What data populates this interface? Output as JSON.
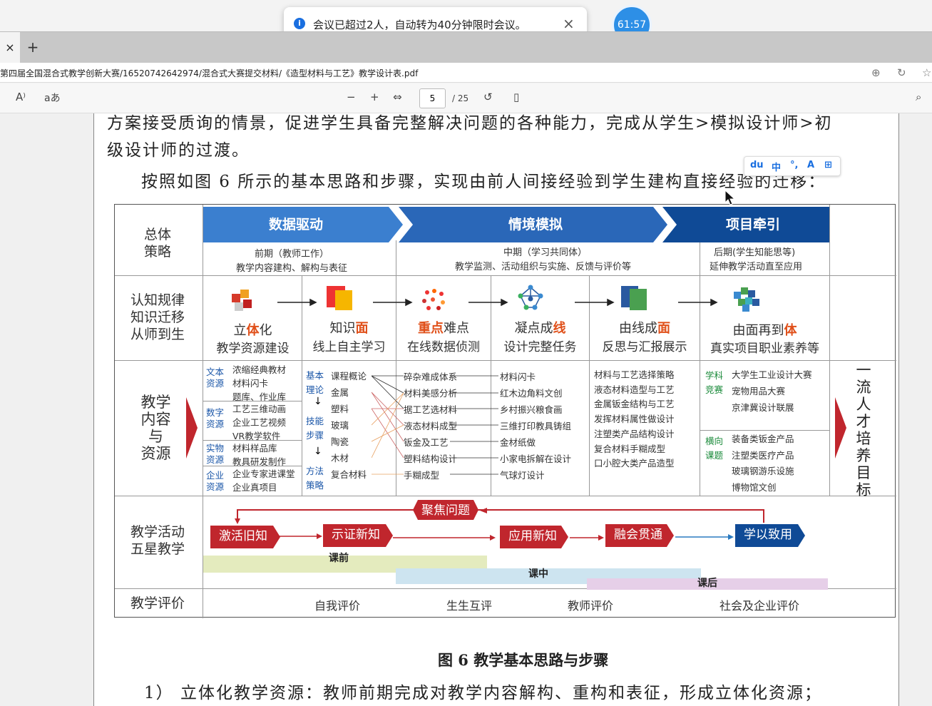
{
  "toast": {
    "message": "会议已超过2人，自动转为40分钟限时会议。",
    "close": "×",
    "info": "i"
  },
  "timer": "61:57",
  "browser": {
    "tab_close": "×",
    "new_tab": "+",
    "url": "第四届全国混合式教学创新大赛/16520742642974/混合式大赛提交材料/《造型材料与工艺》教学设计表.pdf"
  },
  "pdf_toolbar": {
    "read_aloud": "A⁾",
    "translate": "aあ",
    "zoom_out": "−",
    "zoom_in": "+",
    "page": "5",
    "total": "/ 25"
  },
  "ime": {
    "labels": [
      "du",
      "中",
      "°,",
      "A",
      "⊞"
    ]
  },
  "doc": {
    "line1": "方案接受质询的情景，促进学生具备完整解决问题的各种能力，完成从学生>模拟设计师>初",
    "line2": "级设计师的过渡。",
    "line3": "按照如图 6 所示的基本思路和步骤，实现由前人间接经验到学生建构直接经验的迁移：",
    "caption": "图 6 教学基本思路与步骤",
    "line4": "1） 立体化教学资源：教师前期完成对教学内容解构、重构和表征，形成立体化资源；"
  },
  "diagram": {
    "row_labels": {
      "strategy": "总体\n策略",
      "cognition": "认知规律\n知识迁移\n从师到生",
      "content": "教学\n内容\n与\n资源",
      "activity": "教学活动\n五星教学",
      "evaluation": "教学评价"
    },
    "bands": [
      "数据驱动",
      "情境模拟",
      "项目牵引"
    ],
    "band_subs": [
      {
        "a": "前期（教师工作）",
        "b": "教学内容建构、解构与表征"
      },
      {
        "a": "中期（学习共同体）",
        "b": "教学监测、活动组织与实施、反馈与评价等"
      },
      {
        "a": "后期(学生知能思等)",
        "b": "延伸教学活动直至应用"
      }
    ],
    "cog": [
      {
        "pre": "立",
        "hi": "体",
        "post": "化",
        "sub": "教学资源建设"
      },
      {
        "pre": "知识",
        "hi": "面",
        "post": "",
        "sub": "线上自主学习"
      },
      {
        "pre": "重",
        "hi": "点",
        "post": "难点",
        "sub": "在线数据侦测"
      },
      {
        "pre": "凝点成",
        "hi": "线",
        "post": "",
        "sub": "设计完整任务"
      },
      {
        "pre": "由线成",
        "hi": "面",
        "post": "",
        "sub": "反思与汇报展示"
      },
      {
        "pre": "由面再到",
        "hi": "体",
        "post": "",
        "sub": "真实项目职业素养等"
      }
    ],
    "res_types": [
      {
        "label": "文本\n资源",
        "items": "浓缩经典教材\n材料闪卡\n题库、作业库"
      },
      {
        "label": "数字\n资源",
        "items": "工艺三维动画\n企业工艺视频\nVR教学软件"
      },
      {
        "label": "实物\n资源",
        "items": "材料样品库\n教具研发制作"
      },
      {
        "label": "企业\n资源",
        "items": "企业专家进课堂\n企业真项目"
      }
    ],
    "theory": {
      "a": "基本\n理论",
      "b": "技能\n步骤",
      "c": "方法\n策略"
    },
    "materials": [
      "课程概论",
      "金属",
      "塑料",
      "玻璃",
      "陶瓷",
      "木材",
      "复合材料"
    ],
    "processes": [
      "碎杂难成体系",
      "材料美感分析",
      "据工艺选材料",
      "液态材料成型",
      "钣金及工艺",
      "塑料结构设计",
      "手糊成型"
    ],
    "outputs": [
      "材料闪卡",
      "红木边角料文创",
      "乡村振兴粮食画",
      "三维打印教具铸组",
      "金材纸做",
      "小家电拆解在设计",
      "气球灯设计"
    ],
    "topics": [
      "材料与工艺选择策略",
      "液态材料造型与工艺",
      "金属钣金结构与工艺",
      "发挥材料属性做设计",
      "注塑类产品结构设计",
      "复合材料手糊成型",
      "口小腔大类产品造型"
    ],
    "contest_label": "学科\n竞赛",
    "contests": [
      "大学生工业设计大赛",
      "宠物用品大赛",
      "京津冀设计联展"
    ],
    "project_label": "横向\n课题",
    "projects": [
      "装备类钣金产品",
      "注塑类医疗产品",
      "玻璃钢游乐设施",
      "博物馆文创"
    ],
    "goal": "一流人才培养目标",
    "focus": "聚焦问题",
    "steps": [
      "激活旧知",
      "示证新知",
      "应用新知",
      "融会贯通",
      "学以致用"
    ],
    "phases": [
      "课前",
      "课中",
      "课后"
    ],
    "evals": [
      "自我评价",
      "生生互评",
      "教师评价",
      "社会及企业评价"
    ]
  }
}
